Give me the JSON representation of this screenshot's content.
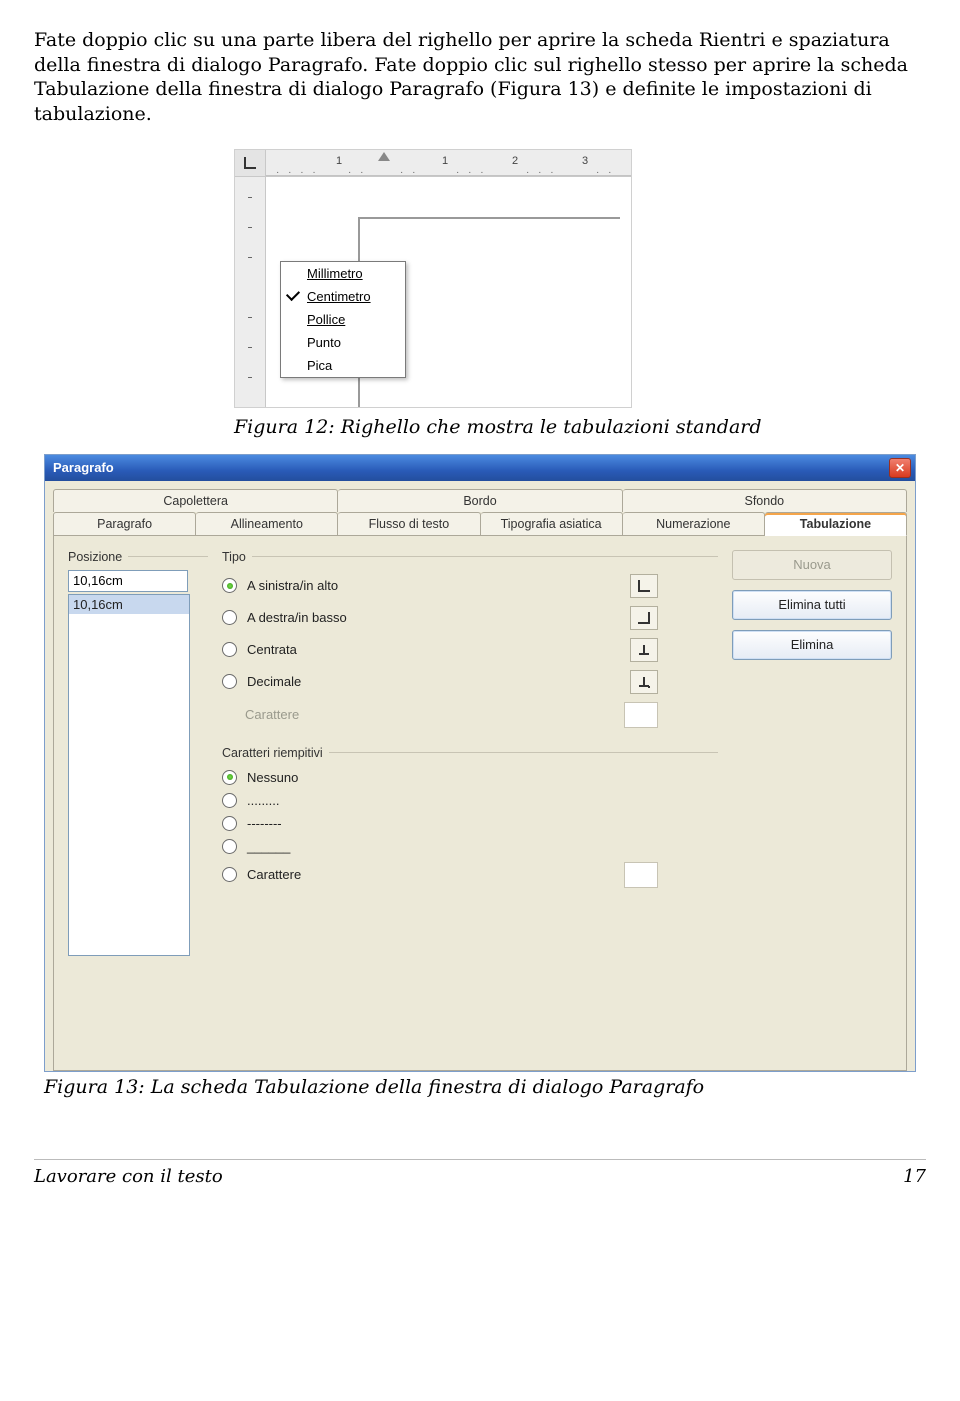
{
  "body_text": "Fate doppio clic su una parte libera del righello per aprire la scheda Rientri e spaziatura della finestra di dialogo Paragrafo. Fate doppio clic sul righello stesso per aprire la scheda Tabulazione della finestra di dialogo Paragrafo (Figura 13) e definite le impostazioni di tabulazione.",
  "fig12": {
    "caption": "Figura 12: Righello che mostra le tabulazioni standard",
    "ruler_numbers": [
      "1",
      "1",
      "2",
      "3"
    ],
    "menu": {
      "millimetro": "Millimetro",
      "centimetro": "Centimetro",
      "pollice": "Pollice",
      "punto": "Punto",
      "pica": "Pica"
    }
  },
  "fig13": {
    "caption": "Figura 13: La scheda Tabulazione della finestra di dialogo Paragrafo",
    "title": "Paragrafo",
    "tabs_top": [
      "Capolettera",
      "Bordo",
      "Sfondo"
    ],
    "tabs_bot": [
      "Paragrafo",
      "Allineamento",
      "Flusso di testo",
      "Tipografia asiatica",
      "Numerazione",
      "Tabulazione"
    ],
    "grp_pos": "Posizione",
    "pos_value": "10,16cm",
    "pos_list_item": "10,16cm",
    "grp_tipo": "Tipo",
    "tipo": {
      "sinistra": "A sinistra/in alto",
      "destra": "A destra/in basso",
      "centrata": "Centrata",
      "decimale": "Decimale",
      "carattere": "Carattere"
    },
    "grp_fill": "Caratteri riempitivi",
    "fill": {
      "nessuno": "Nessuno",
      "dots": ".........",
      "dashes": "--------",
      "unders": "______",
      "carattere": "Carattere"
    },
    "buttons": {
      "nuova": "Nuova",
      "elimina_tutti": "Elimina tutti",
      "elimina": "Elimina"
    }
  },
  "footer": {
    "left": "Lavorare con il testo",
    "right": "17"
  }
}
